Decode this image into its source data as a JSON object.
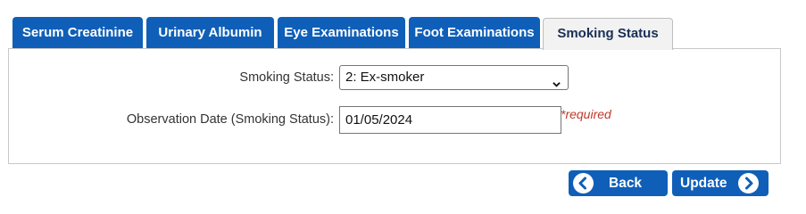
{
  "tabs": [
    {
      "label": "Serum Creatinine",
      "active": false
    },
    {
      "label": "Urinary Albumin",
      "active": false
    },
    {
      "label": "Eye Examinations",
      "active": false
    },
    {
      "label": "Foot Examinations",
      "active": false
    },
    {
      "label": "Smoking Status",
      "active": true
    }
  ],
  "form": {
    "smoking_status_label": "Smoking Status:",
    "smoking_status_value": "2: Ex-smoker",
    "observation_date_label": "Observation Date (Smoking Status):",
    "observation_date_value": "01/05/2024",
    "required_text": "*required"
  },
  "buttons": {
    "back_label": "Back",
    "update_label": "Update"
  },
  "colors": {
    "tab_blue": "#0f5fb8",
    "required_red": "#c0392b"
  }
}
